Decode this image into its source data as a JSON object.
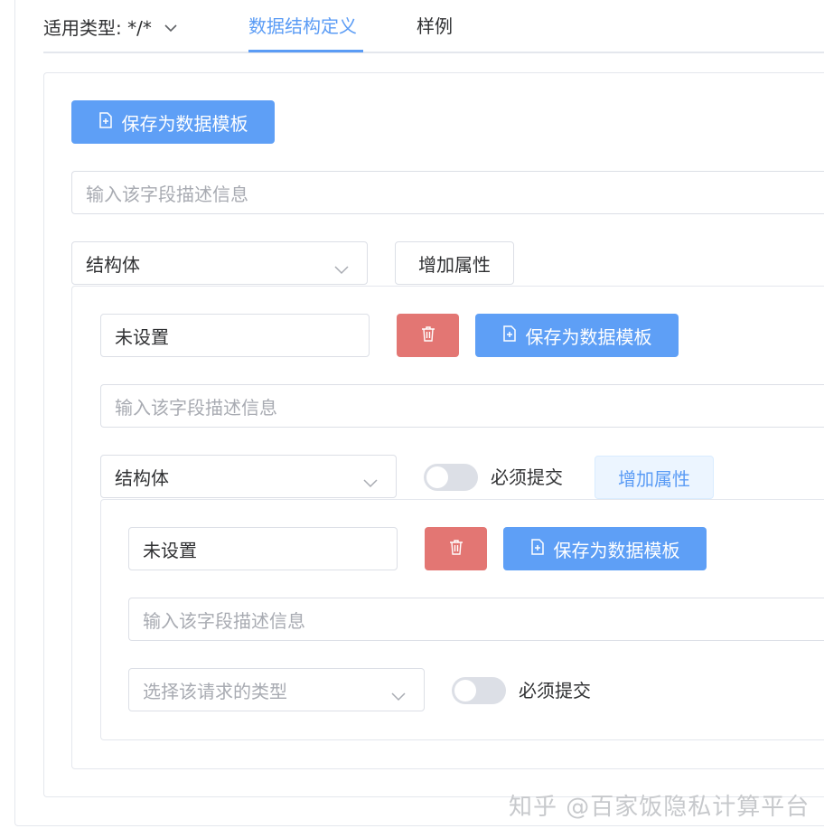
{
  "tabs": {
    "type_label": "适用类型: */*",
    "definition_label": "数据结构定义",
    "sample_label": "样例"
  },
  "level1": {
    "save_template_label": "保存为数据模板",
    "description_placeholder": "输入该字段描述信息",
    "type_value": "结构体",
    "add_property_label": "增加属性"
  },
  "level2": {
    "name_value": "未设置",
    "save_template_label": "保存为数据模板",
    "description_placeholder": "输入该字段描述信息",
    "type_value": "结构体",
    "required_label": "必须提交",
    "add_property_label": "增加属性"
  },
  "level3": {
    "name_value": "未设置",
    "save_template_label": "保存为数据模板",
    "description_placeholder": "输入该字段描述信息",
    "type_placeholder": "选择该请求的类型",
    "required_label": "必须提交"
  },
  "colors": {
    "primary": "#5e9ff6",
    "danger": "#e37673",
    "active_tab": "#5b9cf5"
  },
  "watermark": "知乎 @百家饭隐私计算平台"
}
